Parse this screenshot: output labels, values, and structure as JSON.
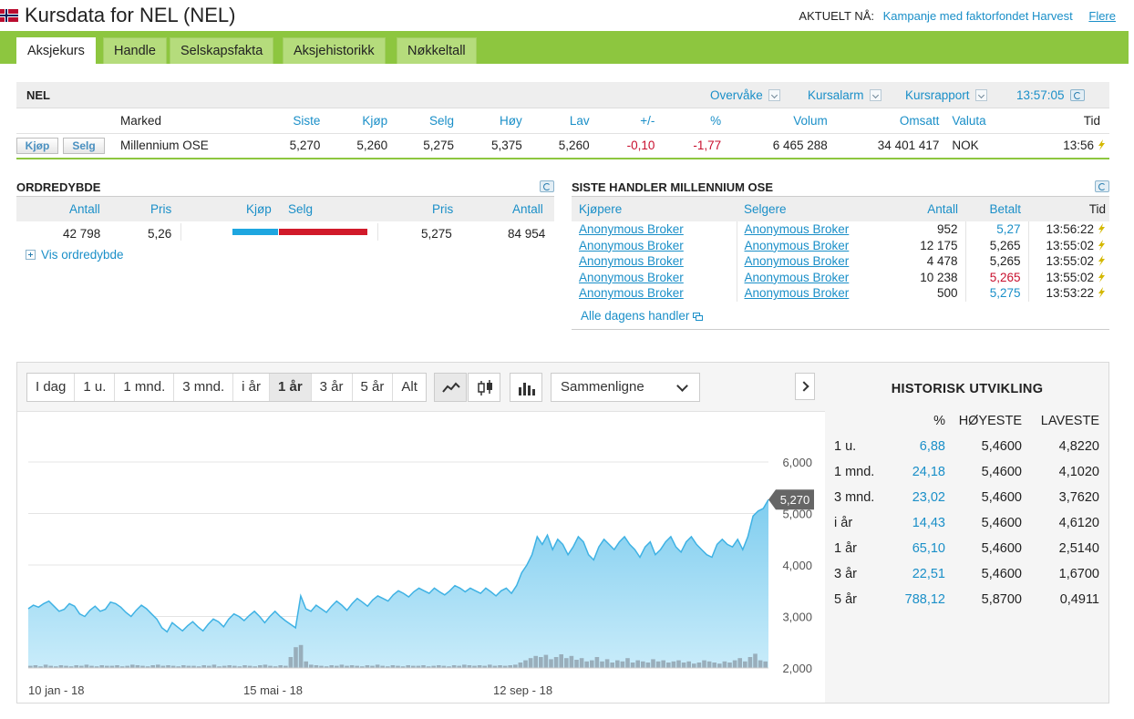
{
  "header": {
    "title": "Kursdata for NEL (NEL)",
    "aktuelt_label": "AKTUELT NÅ:",
    "campaign": "Kampanje med faktorfondet Harvest",
    "more": "Flere"
  },
  "tabs": [
    {
      "label": "Aksjekurs",
      "active": true
    },
    {
      "label": "Handle"
    },
    {
      "label": "Selskapsfakta"
    },
    {
      "label": "Aksjehistorikk"
    },
    {
      "label": "Nøkkeltall"
    }
  ],
  "quote": {
    "name": "NEL",
    "tools": {
      "watch": "Overvåke",
      "alarm": "Kursalarm",
      "report": "Kursrapport",
      "time": "13:57:05"
    },
    "columns": [
      "Marked",
      "Siste",
      "Kjøp",
      "Selg",
      "Høy",
      "Lav",
      "+/-",
      "%",
      "Volum",
      "Omsatt",
      "Valuta",
      "Tid"
    ],
    "buy_button": "Kjøp",
    "sell_button": "Selg",
    "row": {
      "market": "Millennium OSE",
      "last": "5,270",
      "bid": "5,260",
      "ask": "5,275",
      "high": "5,375",
      "low": "5,260",
      "change": "-0,10",
      "pct": "-1,77",
      "volume": "6 465 288",
      "turnover": "34 401 417",
      "currency": "NOK",
      "time": "13:56"
    }
  },
  "orderbook": {
    "title": "ORDREDYBDE",
    "headers": {
      "antall": "Antall",
      "pris": "Pris",
      "kjop": "Kjøp",
      "selg": "Selg",
      "pris2": "Pris",
      "antall2": "Antall"
    },
    "row": {
      "buy_qty": "42 798",
      "buy_price": "5,26",
      "sell_price": "5,275",
      "sell_qty": "84 954"
    },
    "buy_fraction": 0.34,
    "sell_fraction": 0.66,
    "show_more": "Vis ordredybde"
  },
  "trades": {
    "title": "SISTE HANDLER MILLENNIUM OSE",
    "headers": {
      "buyer": "Kjøpere",
      "seller": "Selgere",
      "qty": "Antall",
      "paid": "Betalt",
      "time": "Tid"
    },
    "rows": [
      {
        "buyer": "Anonymous Broker",
        "seller": "Anonymous Broker",
        "qty": "952",
        "paid": "5,27",
        "time": "13:56:22",
        "color": "#1a8fc8"
      },
      {
        "buyer": "Anonymous Broker",
        "seller": "Anonymous Broker",
        "qty": "12 175",
        "paid": "5,265",
        "time": "13:55:02",
        "color": "#222222"
      },
      {
        "buyer": "Anonymous Broker",
        "seller": "Anonymous Broker",
        "qty": "4 478",
        "paid": "5,265",
        "time": "13:55:02",
        "color": "#222222"
      },
      {
        "buyer": "Anonymous Broker",
        "seller": "Anonymous Broker",
        "qty": "10 238",
        "paid": "5,265",
        "time": "13:55:02",
        "color": "#c8102e"
      },
      {
        "buyer": "Anonymous Broker",
        "seller": "Anonymous Broker",
        "qty": "500",
        "paid": "5,275",
        "time": "13:53:22",
        "color": "#1a8fc8"
      }
    ],
    "all_link": "Alle dagens handler"
  },
  "chart_toolbar": {
    "periods": [
      "I dag",
      "1 u.",
      "1 mnd.",
      "3 mnd.",
      "i år",
      "1 år",
      "3 år",
      "5 år",
      "Alt"
    ],
    "active_period": "1 år",
    "compare": "Sammenligne"
  },
  "chart_data": {
    "type": "area",
    "y_ticks": [
      "6,000",
      "5,000",
      "4,000",
      "3,000",
      "2,000"
    ],
    "ylim": [
      2,
      6
    ],
    "x_tick_labels": [
      "10 jan - 18",
      "15 mai - 18",
      "12 sep - 18"
    ],
    "last_value_label": "5,270",
    "series": [
      {
        "values": [
          3.15,
          3.22,
          3.18,
          3.25,
          3.3,
          3.2,
          3.1,
          3.14,
          3.25,
          3.2,
          3.05,
          3.0,
          3.12,
          3.2,
          3.1,
          3.14,
          3.28,
          3.25,
          3.18,
          3.08,
          3.0,
          3.12,
          3.22,
          3.15,
          3.05,
          2.95,
          2.78,
          2.7,
          2.88,
          2.8,
          2.72,
          2.82,
          2.9,
          2.8,
          2.72,
          2.85,
          2.95,
          2.9,
          2.8,
          2.95,
          3.05,
          3.0,
          2.92,
          3.02,
          3.1,
          3.0,
          2.88,
          3.0,
          3.1,
          3.0,
          2.92,
          2.85,
          2.78,
          3.4,
          3.15,
          3.1,
          3.22,
          3.15,
          3.08,
          3.2,
          3.3,
          3.22,
          3.12,
          3.25,
          3.35,
          3.28,
          3.2,
          3.32,
          3.4,
          3.35,
          3.3,
          3.42,
          3.5,
          3.45,
          3.38,
          3.48,
          3.55,
          3.5,
          3.45,
          3.55,
          3.48,
          3.42,
          3.5,
          3.6,
          3.55,
          3.48,
          3.55,
          3.5,
          3.45,
          3.55,
          3.48,
          3.4,
          3.5,
          3.55,
          3.45,
          3.6,
          3.85,
          4.0,
          4.2,
          4.55,
          4.4,
          4.58,
          4.3,
          4.5,
          4.4,
          4.2,
          4.35,
          4.55,
          4.45,
          4.2,
          4.1,
          4.35,
          4.5,
          4.4,
          4.3,
          4.45,
          4.55,
          4.4,
          4.3,
          4.15,
          4.35,
          4.45,
          4.2,
          4.3,
          4.45,
          4.55,
          4.35,
          4.25,
          4.45,
          4.55,
          4.4,
          4.3,
          4.2,
          4.15,
          4.4,
          4.5,
          4.4,
          4.35,
          4.5,
          4.3,
          4.55,
          4.95,
          5.05,
          5.1,
          5.27
        ]
      }
    ],
    "volume_bars": [
      0.04,
      0.05,
      0.03,
      0.06,
      0.04,
      0.03,
      0.05,
      0.04,
      0.03,
      0.05,
      0.04,
      0.06,
      0.04,
      0.03,
      0.05,
      0.04,
      0.04,
      0.05,
      0.03,
      0.04,
      0.06,
      0.05,
      0.04,
      0.03,
      0.05,
      0.06,
      0.04,
      0.05,
      0.04,
      0.03,
      0.05,
      0.04,
      0.04,
      0.03,
      0.05,
      0.04,
      0.06,
      0.03,
      0.04,
      0.05,
      0.04,
      0.03,
      0.05,
      0.04,
      0.03,
      0.05,
      0.06,
      0.04,
      0.03,
      0.05,
      0.04,
      0.2,
      0.38,
      0.42,
      0.12,
      0.06,
      0.05,
      0.04,
      0.03,
      0.05,
      0.04,
      0.06,
      0.04,
      0.05,
      0.04,
      0.03,
      0.05,
      0.04,
      0.06,
      0.04,
      0.03,
      0.05,
      0.04,
      0.03,
      0.05,
      0.04,
      0.04,
      0.05,
      0.03,
      0.04,
      0.05,
      0.04,
      0.03,
      0.05,
      0.04,
      0.06,
      0.05,
      0.04,
      0.05,
      0.04,
      0.06,
      0.04,
      0.05,
      0.04,
      0.05,
      0.06,
      0.1,
      0.14,
      0.18,
      0.22,
      0.2,
      0.24,
      0.16,
      0.2,
      0.25,
      0.18,
      0.22,
      0.15,
      0.18,
      0.12,
      0.14,
      0.2,
      0.12,
      0.16,
      0.1,
      0.14,
      0.12,
      0.18,
      0.1,
      0.14,
      0.12,
      0.1,
      0.16,
      0.12,
      0.14,
      0.1,
      0.12,
      0.14,
      0.1,
      0.12,
      0.08,
      0.1,
      0.14,
      0.12,
      0.1,
      0.08,
      0.12,
      0.1,
      0.14,
      0.18,
      0.12,
      0.2,
      0.26,
      0.14,
      0.12
    ]
  },
  "history": {
    "title": "HISTORISK UTVIKLING",
    "headers": [
      "%",
      "HØYESTE",
      "LAVESTE"
    ],
    "rows": [
      {
        "period": "1 u.",
        "pct": "6,88",
        "high": "5,4600",
        "low": "4,8220"
      },
      {
        "period": "1 mnd.",
        "pct": "24,18",
        "high": "5,4600",
        "low": "4,1020"
      },
      {
        "period": "3 mnd.",
        "pct": "23,02",
        "high": "5,4600",
        "low": "3,7620"
      },
      {
        "period": "i år",
        "pct": "14,43",
        "high": "5,4600",
        "low": "4,6120"
      },
      {
        "period": "1 år",
        "pct": "65,10",
        "high": "5,4600",
        "low": "2,5140"
      },
      {
        "period": "3 år",
        "pct": "22,51",
        "high": "5,4600",
        "low": "1,6700"
      },
      {
        "period": "5 år",
        "pct": "788,12",
        "high": "5,8700",
        "low": "0,4911"
      }
    ]
  },
  "colors": {
    "accent_green": "#8dc63f",
    "link_blue": "#1a8fc8",
    "negative_red": "#c8102e",
    "area_fill": "#8fd4f0",
    "bolt_yellow": "#d4b800"
  }
}
